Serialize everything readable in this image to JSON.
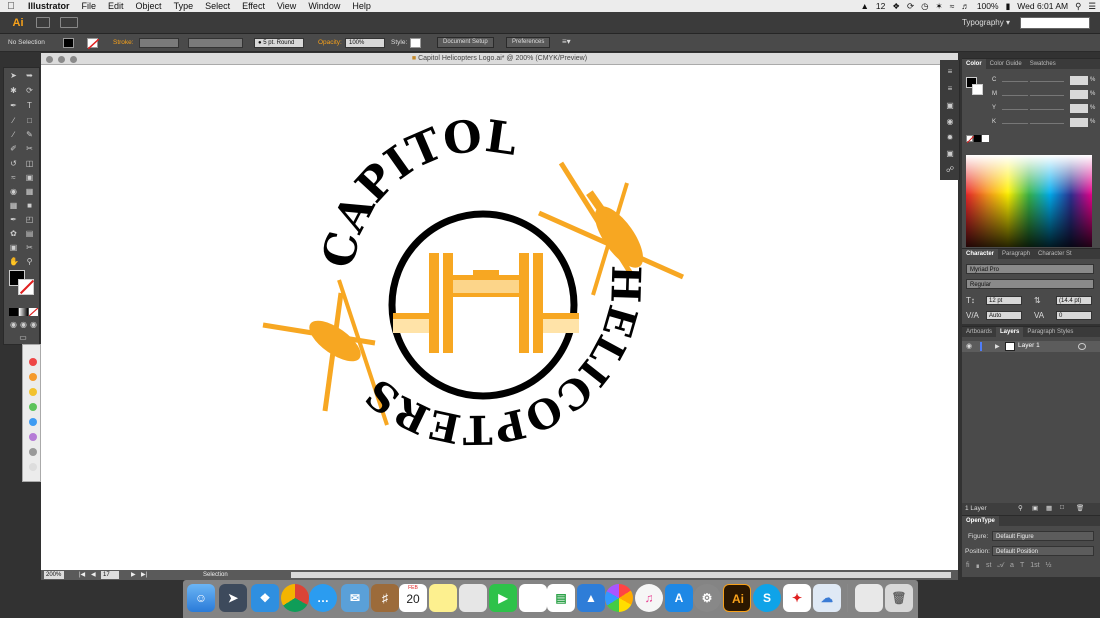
{
  "menubar": {
    "app_name": "Illustrator",
    "items": [
      "File",
      "Edit",
      "Object",
      "Type",
      "Select",
      "Effect",
      "View",
      "Window",
      "Help"
    ],
    "status": {
      "adobe_count": "12",
      "battery": "100%",
      "clock": "Wed 6:01 AM"
    }
  },
  "appbar": {
    "logo": "Ai",
    "workspace": "Typography"
  },
  "controlbar": {
    "selection": "No Selection",
    "stroke_label": "Stroke:",
    "brush": "5 pt. Round",
    "opacity_label": "Opacity:",
    "opacity_value": "100%",
    "style_label": "Style:",
    "document_setup": "Document Setup",
    "preferences": "Preferences"
  },
  "document": {
    "title": "Capitol Helicopters Logo.ai* @ 200% (CMYK/Preview)",
    "zoom": "200%",
    "page": "17",
    "mode": "Selection",
    "artwork": {
      "top_text": "CAPITOL",
      "right_text": "HELICOPTERS",
      "orange": "#f7a722",
      "black": "#000000"
    }
  },
  "panels": {
    "color": {
      "tabs": [
        "Color",
        "Color Guide",
        "Swatches"
      ],
      "channels": [
        "C",
        "M",
        "Y",
        "K"
      ],
      "pct": "%"
    },
    "character": {
      "tabs": [
        "Character",
        "Paragraph",
        "Character St"
      ],
      "font": "Myriad Pro",
      "style": "Regular",
      "size": "12 pt",
      "leading": "(14.4 pt)",
      "kerning": "Auto",
      "tracking": "0"
    },
    "layers": {
      "tabs": [
        "Artboards",
        "Layers",
        "Paragraph Styles"
      ],
      "layer_name": "Layer 1",
      "count": "1 Layer"
    },
    "opentype": {
      "title": "OpenType",
      "figure_label": "Figure:",
      "figure_value": "Default Figure",
      "position_label": "Position:",
      "position_value": "Default Position"
    }
  },
  "dock": {
    "calendar_month": "FEB",
    "calendar_day": "20",
    "ai_label": "Ai",
    "skype_label": "S"
  }
}
